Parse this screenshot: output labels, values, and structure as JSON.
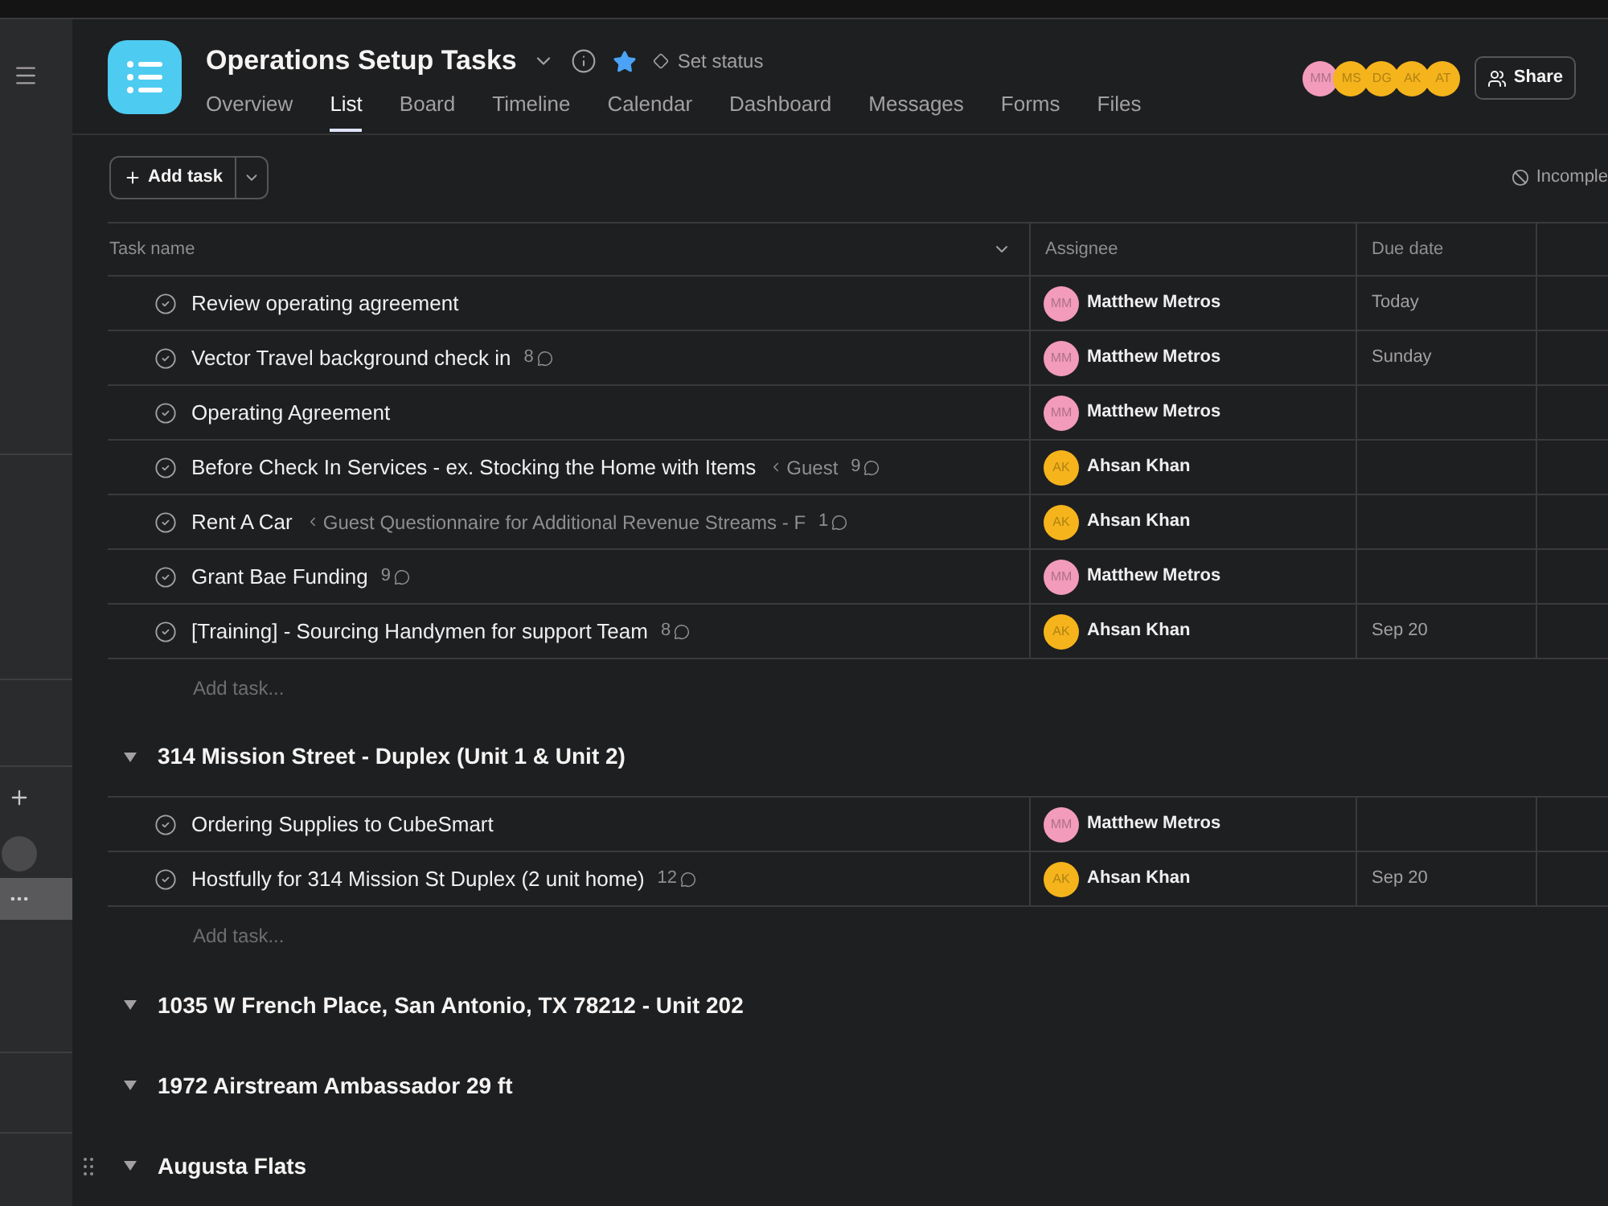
{
  "project": {
    "title": "Operations Setup Tasks",
    "starred": true,
    "status_label": "Set status"
  },
  "tabs": [
    {
      "label": "Overview",
      "selected": false
    },
    {
      "label": "List",
      "selected": true
    },
    {
      "label": "Board",
      "selected": false
    },
    {
      "label": "Timeline",
      "selected": false
    },
    {
      "label": "Calendar",
      "selected": false
    },
    {
      "label": "Dashboard",
      "selected": false
    },
    {
      "label": "Messages",
      "selected": false
    },
    {
      "label": "Forms",
      "selected": false
    },
    {
      "label": "Files",
      "selected": false
    }
  ],
  "members": [
    {
      "initials": "MM",
      "color": "#f29bbb"
    },
    {
      "initials": "MS",
      "color": "#f5b41c"
    },
    {
      "initials": "DG",
      "color": "#f5b41c"
    },
    {
      "initials": "AK",
      "color": "#f5b41c"
    },
    {
      "initials": "AT",
      "color": "#f5b41c"
    }
  ],
  "share_label": "Share",
  "toolbar": {
    "add_task": "Add task",
    "filter": "Incomple"
  },
  "sidebar": {
    "items": [
      {
        "kind": "add",
        "selected": false
      },
      {
        "kind": "avatar",
        "selected": false
      },
      {
        "kind": "more",
        "selected": true
      }
    ]
  },
  "table": {
    "columns": [
      "Task name",
      "Assignee",
      "Due date"
    ],
    "tasks": [
      {
        "name": "Review operating agreement",
        "completed": false,
        "assignee": {
          "initials": "MM",
          "name": "Matthew Metros",
          "color": "#f29bbb"
        },
        "due": "Today"
      },
      {
        "name": "Vector Travel background check in",
        "completed": false,
        "comments": "8",
        "assignee": {
          "initials": "MM",
          "name": "Matthew Metros",
          "color": "#f29bbb"
        },
        "due": "Sunday"
      },
      {
        "name": "Operating Agreement",
        "completed": false,
        "assignee": {
          "initials": "MM",
          "name": "Matthew Metros",
          "color": "#f29bbb"
        }
      },
      {
        "name": "Before Check In Services - ex. Stocking the Home with Items",
        "completed": false,
        "parent": "Guest",
        "comments": "9",
        "assignee": {
          "initials": "AK",
          "name": "Ahsan Khan",
          "color": "#f5b41c"
        }
      },
      {
        "name": "Rent A Car",
        "completed": false,
        "parent": "Guest Questionnaire for Additional Revenue Streams - F",
        "comments": "1",
        "assignee": {
          "initials": "AK",
          "name": "Ahsan Khan",
          "color": "#f5b41c"
        }
      },
      {
        "name": "Grant Bae Funding",
        "completed": false,
        "comments": "9",
        "assignee": {
          "initials": "MM",
          "name": "Matthew Metros",
          "color": "#f29bbb"
        }
      },
      {
        "name": "[Training] - Sourcing Handymen for support Team",
        "completed": false,
        "comments": "8",
        "assignee": {
          "initials": "AK",
          "name": "Ahsan Khan",
          "color": "#f5b41c"
        },
        "due": "Sep 20"
      }
    ],
    "add_task": "Add task..."
  },
  "sections": [
    {
      "name": "314 Mission Street - Duplex (Unit 1 & Unit 2)",
      "expanded": true,
      "hovered": false,
      "tasks": [
        {
          "name": "Ordering Supplies to CubeSmart",
          "completed": false,
          "assignee": {
            "initials": "MM",
            "name": "Matthew Metros",
            "color": "#f29bbb"
          }
        },
        {
          "name": "Hostfully for 314 Mission St Duplex (2 unit home)",
          "completed": false,
          "comments": "12",
          "assignee": {
            "initials": "AK",
            "name": "Ahsan Khan",
            "color": "#f5b41c"
          },
          "due": "Sep 20"
        }
      ],
      "add_task": "Add task..."
    },
    {
      "name": "1035 W French Place, San Antonio, TX 78212 - Unit 202",
      "expanded": true,
      "hovered": false
    },
    {
      "name": "1972 Airstream Ambassador 29 ft",
      "expanded": true,
      "hovered": false
    },
    {
      "name": "Augusta Flats",
      "expanded": true,
      "hovered": true
    }
  ]
}
